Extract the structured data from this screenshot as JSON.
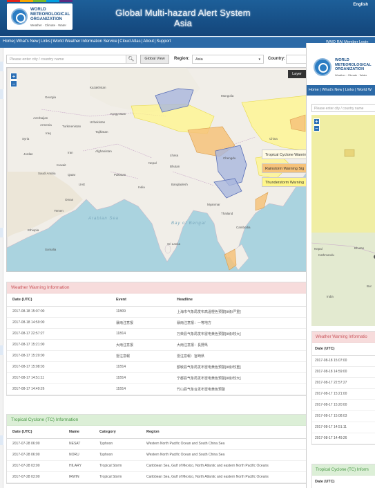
{
  "header": {
    "org_line1": "WORLD",
    "org_line2": "METEOROLOGICAL",
    "org_line3": "ORGANIZATION",
    "tagline": "Weather · Climate · Water",
    "title_line1": "Global Multi-hazard Alert System",
    "title_line2": "Asia",
    "language": "English"
  },
  "nav": {
    "items": [
      "Home",
      "What's New",
      "Links",
      "World Weather Information Service",
      "Cloud Atlas",
      "About",
      "Support"
    ],
    "right_link": "WMO RAI Member Login"
  },
  "search": {
    "placeholder": "Please enter city / country name",
    "global_view_label": "Global View",
    "region_label": "Region:",
    "region_value": "Asia",
    "country_label": "Country:"
  },
  "map": {
    "layer_button": "Layer",
    "legend": [
      {
        "label": "Tropical Cyclone Warning",
        "color": "#fffbe6"
      },
      {
        "label": "Rainstorm Warning Sig",
        "color": "#f6c27a"
      },
      {
        "label": "Thunderstorm Warning",
        "color": "#fff68a"
      }
    ],
    "labels": [
      {
        "text": "Kazakhstan"
      },
      {
        "text": "Mongolia"
      },
      {
        "text": "Georgia"
      },
      {
        "text": "Azerbaijan"
      },
      {
        "text": "Armenia"
      },
      {
        "text": "Turkmenistan"
      },
      {
        "text": "Uzbekistan"
      },
      {
        "text": "Kyrgyzstan"
      },
      {
        "text": "Tajikistan"
      },
      {
        "text": "Iraq"
      },
      {
        "text": "Iran"
      },
      {
        "text": "Afghanistan"
      },
      {
        "text": "Pakistan"
      },
      {
        "text": "Syria"
      },
      {
        "text": "Jordan"
      },
      {
        "text": "Kuwait"
      },
      {
        "text": "Saudi Arabia"
      },
      {
        "text": "Qatar"
      },
      {
        "text": "UAE"
      },
      {
        "text": "Oman"
      },
      {
        "text": "Yemen"
      },
      {
        "text": "Somalia"
      },
      {
        "text": "Ethiopia"
      },
      {
        "text": "Nepal"
      },
      {
        "text": "Bhutan"
      },
      {
        "text": "India"
      },
      {
        "text": "Bangladesh"
      },
      {
        "text": "Myanmar"
      },
      {
        "text": "Thailand"
      },
      {
        "text": "Cambodia"
      },
      {
        "text": "Sri Lanka"
      },
      {
        "text": "China"
      },
      {
        "text": "Chengdu"
      },
      {
        "text": "Lhasa"
      }
    ],
    "seas": [
      "Arabian Sea",
      "Bay of Bengal"
    ]
  },
  "weather_warning": {
    "title": "Weather Warning Information",
    "columns": [
      "Date (UTC)",
      "Event",
      "Headline"
    ],
    "rows": [
      [
        "2017-08-18 15:07:00",
        "11B09",
        "上海市气象局发布高温橙色预警[Ⅲ级/严重]"
      ],
      [
        "2017-08-18 14:59:00",
        "暴雨注意报",
        "暴雨注意报：一等地方"
      ],
      [
        "2017-08-17 22:57:27",
        "11B14",
        "万荣县气象局发布雷电黄色预警[Ⅲ级/较大]"
      ],
      [
        "2017-08-17 15:21:00",
        "大雨注意报",
        "大雨注意报：長野県"
      ],
      [
        "2017-08-17 15:20:00",
        "雷注意報",
        "雷注意報：宮崎県"
      ],
      [
        "2017-08-17 15:08:03",
        "11B14",
        "额敏县气象局发布雷电黄色预警[Ⅲ级/较重]"
      ],
      [
        "2017-08-17 14:51:11",
        "11B14",
        "宁都县气象局发布雷电黄色预警[Ⅲ级/较大]"
      ],
      [
        "2017-08-17 14:49:26",
        "11B14",
        "竹山县气象台发布雷电黄色预警"
      ]
    ]
  },
  "tropical_cyclone": {
    "title": "Tropical Cyclone (TC) Information",
    "columns": [
      "Date (UTC)",
      "Name",
      "Category",
      "Region"
    ],
    "rows": [
      [
        "2017-07-28 06:00",
        "NESAT",
        "Typhoon",
        "Western North Pacific Ocean and South China Sea"
      ],
      [
        "2017-07-28 06:00",
        "NORU",
        "Typhoon",
        "Western North Pacific Ocean and South China Sea"
      ],
      [
        "2017-07-28 03:00",
        "HILARY",
        "Tropical Storm",
        "Caribbean Sea, Gulf of Mexico, North Atlantic and eastern North Pacific Oceans"
      ],
      [
        "2017-07-28 03:00",
        "IRWIN",
        "Tropical Storm",
        "Caribbean Sea, Gulf of Mexico, North Atlantic and eastern North Pacific Oceans"
      ]
    ]
  },
  "second_window": {
    "org_line1": "WORLD",
    "org_line2": "METEOROLOGICAL",
    "org_line3": "ORGANIZATION",
    "tagline": "Weather · Climate · Water",
    "nav_text": "Home | What's New | Links | World W",
    "search_placeholder": "Please enter city / country name",
    "map_labels": [
      "Nepal",
      "Kathmandu",
      "Bhutan",
      "India",
      "Bur"
    ],
    "weather_title": "Weather Warning Informatio",
    "date_header": "Date (UTC)",
    "dates": [
      "2017-08-18 15:07:00",
      "2017-08-18 14:59:00",
      "2017-08-17 22:57:27",
      "2017-08-17 15:21:00",
      "2017-08-17 15:20:00",
      "2017-08-17 15:08:03",
      "2017-08-17 14:51:11",
      "2017-08-17 14:49:26"
    ],
    "tc_title": "Tropical Cyclone (TC) Inform",
    "tc_date_header": "Date (UTC)"
  },
  "colors": {
    "nav_blue": "#2c6aa7",
    "header_blue": "#1d5f99",
    "warning_red": "#c9545a",
    "tc_green": "#4a9a47",
    "strip": [
      "#e2231a",
      "#f7a600",
      "#76b82a",
      "#009ee0",
      "#5a2b81"
    ]
  }
}
